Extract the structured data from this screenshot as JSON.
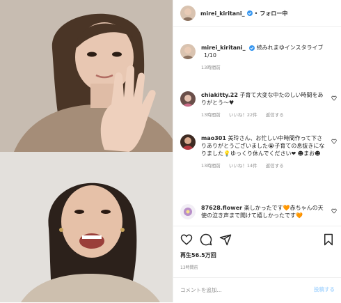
{
  "header": {
    "username": "mirei_kiritani_",
    "dot": "•",
    "follow_label": "フォロー中"
  },
  "caption": {
    "username": "mirei_kiritani_",
    "text": "続みれまゆインスタライブ",
    "counter": "1/10",
    "time": "13時間前"
  },
  "comments": [
    {
      "username": "chiakitty.22",
      "text": "子育て大変な中たのしい時間をありがとう〜♥",
      "time": "13時間前",
      "likes": "いいね！22件",
      "reply": "返信する"
    },
    {
      "username": "mao301",
      "text": "美玲さん、お忙しい中時間作って下さりありがとうございました😭子育ての息抜きになりました💡ゆっくり休んでください❤︎ ☻まお☻",
      "time": "13時間前",
      "likes": "いいね！14件",
      "reply": "返信する"
    },
    {
      "username": "87628.flower",
      "text": "楽しかったです🧡赤ちゃんの天使の泣き声まで聞けて嬉しかったです🧡",
      "time": "",
      "likes": "",
      "reply": ""
    }
  ],
  "stats": {
    "views": "再生56.5万回",
    "time": "13時間前"
  },
  "input": {
    "placeholder": "コメントを追加...",
    "post_label": "投稿する"
  },
  "colors": {
    "verified": "#3897f0",
    "post_button": "#b3dbff",
    "meta_text": "#8e8e8e"
  },
  "icons": [
    "verified-badge-icon",
    "heart-icon",
    "comment-icon",
    "share-icon",
    "bookmark-icon"
  ]
}
